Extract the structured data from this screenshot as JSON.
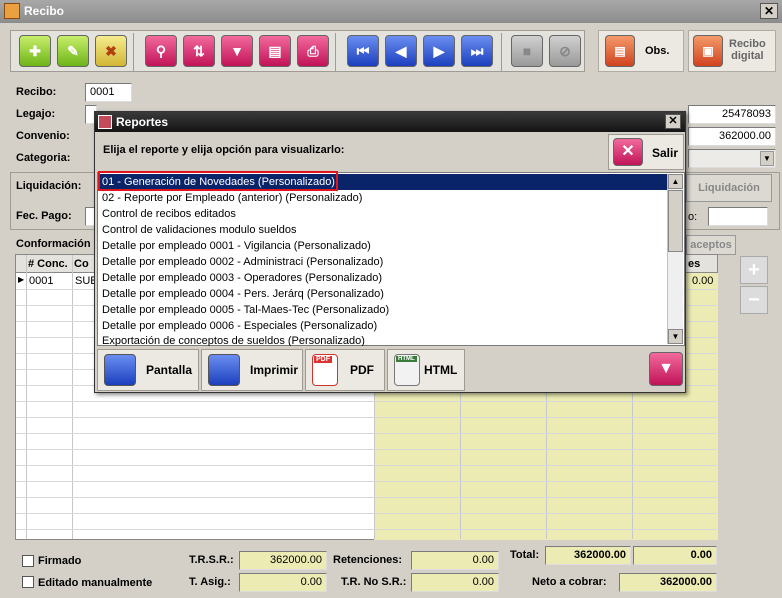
{
  "window": {
    "title": "Recibo"
  },
  "side_buttons": {
    "obs": "Obs.",
    "recibo_digital": "Recibo\ndigital"
  },
  "form": {
    "recibo_label": "Recibo:",
    "recibo_value": "0001",
    "legajo_label": "Legajo:",
    "legajo_right_value": "25478093",
    "convenio_label": "Convenio:",
    "convenio_right_value": "362000.00",
    "categoria_label": "Categoria:",
    "liquidacion_label": "Liquidación:",
    "liquidacion_button": "Liquidación",
    "fec_pago_label": "Fec. Pago:",
    "fec_pago_right_label": "o:",
    "conformacion_label": "Conformación",
    "conceptos_button": "aceptos"
  },
  "grid": {
    "headers": {
      "num_conc": "# Conc.",
      "con": "Co",
      "col_right": "es"
    },
    "rows": [
      {
        "marker": "▶",
        "num": "0001",
        "con": "SUE",
        "right_value": "0.00"
      }
    ]
  },
  "dialog": {
    "title": "Reportes",
    "prompt": "Elija el reporte y elija opción para visualizarlo:",
    "exit_label": "Salir",
    "reports": [
      "01 - Generación de Novedades (Personalizado)",
      "02 - Reporte por Empleado (anterior) (Personalizado)",
      "Control de recibos editados",
      "Control de validaciones modulo sueldos",
      "Detalle por empleado 0001 - Vigilancia (Personalizado)",
      "Detalle por empleado 0002 - Administraci (Personalizado)",
      "Detalle por empleado 0003 - Operadores (Personalizado)",
      "Detalle por empleado 0004 - Pers. Jerárq (Personalizado)",
      "Detalle por empleado 0005 - Tal-Maes-Tec (Personalizado)",
      "Detalle por empleado 0006 - Especiales (Personalizado)",
      "Exportación de conceptos de sueldos (Personalizado)"
    ],
    "outputs": {
      "pantalla": "Pantalla",
      "imprimir": "Imprimir",
      "pdf": "PDF",
      "html": "HTML"
    },
    "pdf_badge": "PDF",
    "html_badge": "HTML"
  },
  "footer": {
    "firmado": "Firmado",
    "editado": "Editado manualmente",
    "trsr_label": "T.R.S.R.:",
    "trsr_value": "362000.00",
    "tasig_label": "T. Asig.:",
    "tasig_value": "0.00",
    "retenciones_label": "Retenciones:",
    "retenciones_value": "0.00",
    "trnosr_label": "T.R. No S.R.:",
    "trnosr_value": "0.00",
    "total_label": "Total:",
    "total_value1": "362000.00",
    "total_value2": "0.00",
    "neto_label": "Neto a cobrar:",
    "neto_value": "362000.00"
  }
}
